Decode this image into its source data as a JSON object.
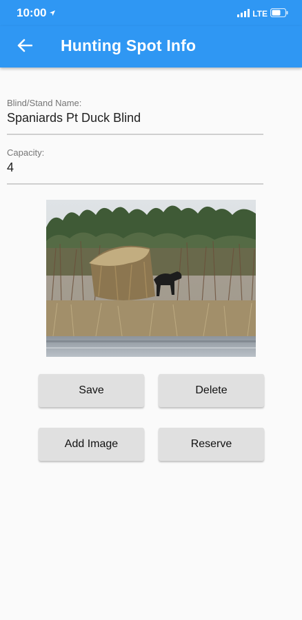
{
  "status_bar": {
    "time": "10:00",
    "network": "LTE",
    "location_icon": "location-arrow-icon",
    "signal_icon": "signal-bars-icon",
    "battery_icon": "battery-icon"
  },
  "app_bar": {
    "title": "Hunting Spot Info",
    "back_icon": "back-arrow-icon",
    "color": "#2f97f3"
  },
  "form": {
    "name_label": "Blind/Stand Name:",
    "name_value": "Spaniards Pt Duck Blind",
    "capacity_label": "Capacity:",
    "capacity_value": "4"
  },
  "buttons": {
    "save": "Save",
    "delete": "Delete",
    "add_image": "Add Image",
    "reserve": "Reserve"
  }
}
